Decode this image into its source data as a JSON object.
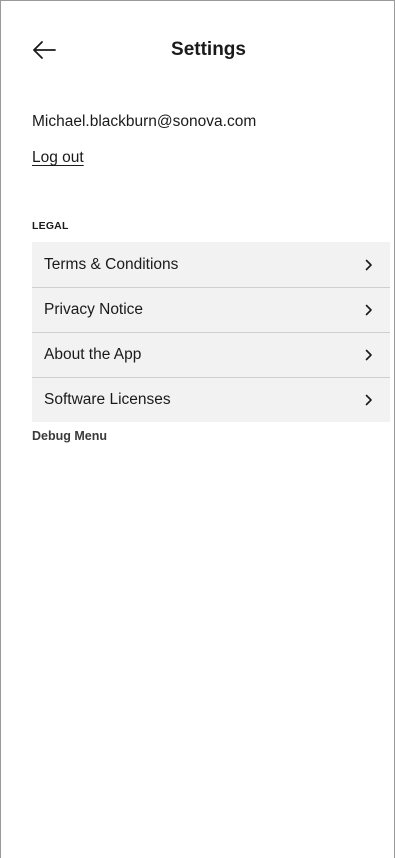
{
  "header": {
    "title": "Settings",
    "back_icon": "arrow-left-icon"
  },
  "account": {
    "email": "Michael.blackburn@sonova.com",
    "logout_label": "Log out"
  },
  "legal": {
    "section_title": "LEGAL",
    "items": [
      {
        "label": "Terms & Conditions",
        "icon": "chevron-right-icon"
      },
      {
        "label": "Privacy Notice",
        "icon": "chevron-right-icon"
      },
      {
        "label": "About the App",
        "icon": "chevron-right-icon"
      },
      {
        "label": "Software Licenses",
        "icon": "chevron-right-icon"
      }
    ]
  },
  "debug": {
    "label": "Debug Menu"
  },
  "colors": {
    "background": "#ffffff",
    "list_background": "#f2f2f2",
    "divider": "#cfcfcf",
    "text": "#1a1a1a"
  }
}
